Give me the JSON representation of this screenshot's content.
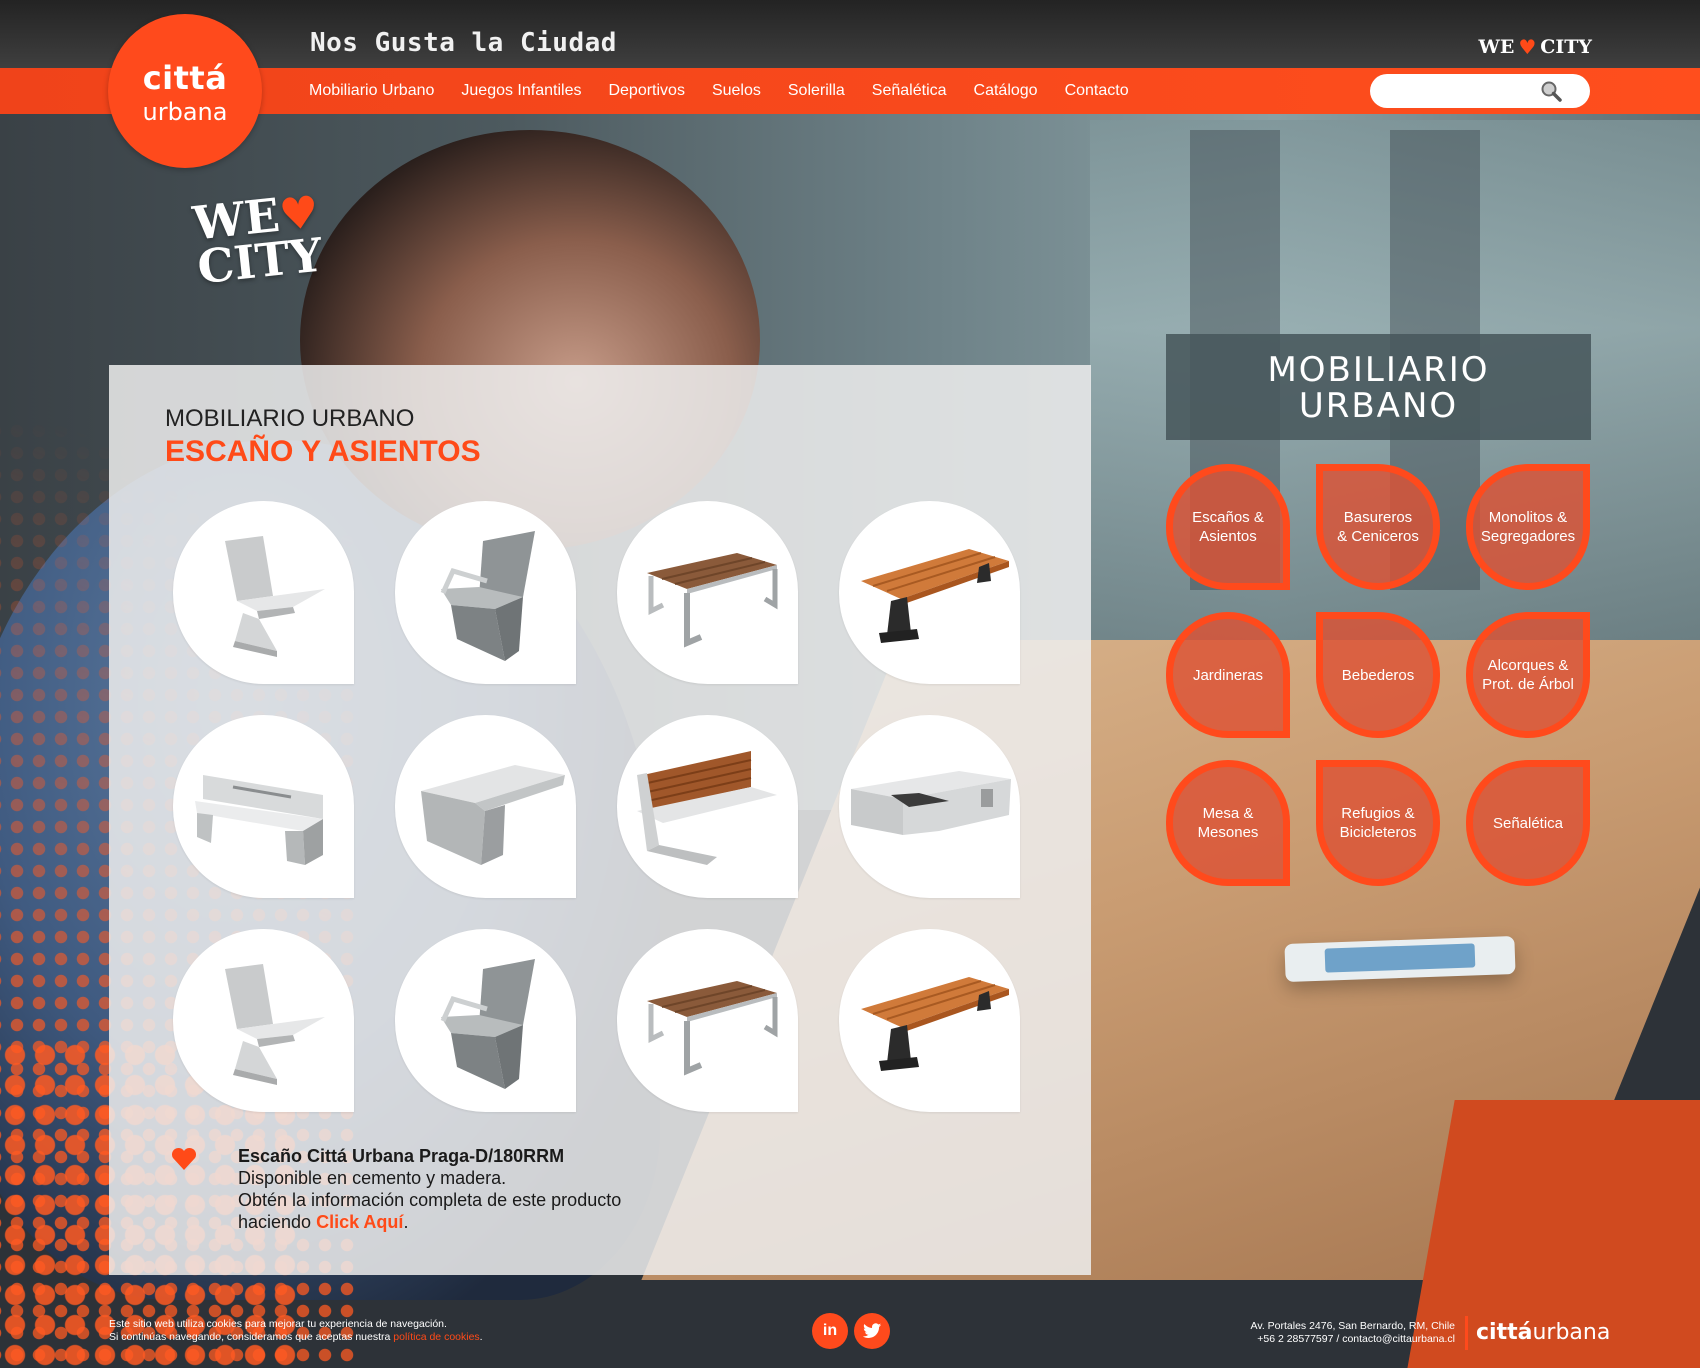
{
  "header": {
    "tagline": "Nos Gusta la Ciudad",
    "we_love": "WE",
    "city": "CITY",
    "logo_line1": "cittá",
    "logo_line2": "urbana",
    "search_placeholder": "",
    "nav": [
      "Mobiliario Urbano",
      "Juegos Infantiles",
      "Deportivos",
      "Suelos",
      "Solerilla",
      "Señalética",
      "Catálogo",
      "Contacto"
    ]
  },
  "badge": {
    "we": "WE",
    "city": "CITY"
  },
  "main": {
    "eyebrow": "MOBILIARIO URBANO",
    "heading": "ESCAÑO Y ASIENTOS",
    "products": [
      {
        "icon": "concrete-chair"
      },
      {
        "icon": "concrete-armchair"
      },
      {
        "icon": "metal-wood-bench"
      },
      {
        "icon": "wood-bench"
      },
      {
        "icon": "concrete-backrest-bench"
      },
      {
        "icon": "concrete-block-seat"
      },
      {
        "icon": "wood-slat-backrest-bench"
      },
      {
        "icon": "concrete-long-bench"
      },
      {
        "icon": "concrete-chair"
      },
      {
        "icon": "concrete-armchair"
      },
      {
        "icon": "metal-wood-bench"
      },
      {
        "icon": "wood-bench"
      }
    ],
    "info": {
      "title": "Escaño Cittá Urbana Praga-D/180RRM",
      "line1": "Disponible en cemento y madera.",
      "line2": "Obtén la información completa de este producto",
      "line3_prefix": "haciendo ",
      "cta": "Click Aquí",
      "line3_suffix": "."
    }
  },
  "sidebar": {
    "title_line1": "MOBILIARIO",
    "title_line2": "URBANO",
    "categories": [
      {
        "l1": "Escaños &",
        "l2": "Asientos"
      },
      {
        "l1": "Basureros",
        "l2": "& Ceniceros"
      },
      {
        "l1": "Monolitos &",
        "l2": "Segregadores"
      },
      {
        "l1": "Jardineras",
        "l2": ""
      },
      {
        "l1": "Bebederos",
        "l2": ""
      },
      {
        "l1": "Alcorques &",
        "l2": "Prot. de Árbol"
      },
      {
        "l1": "Mesa &",
        "l2": "Mesones"
      },
      {
        "l1": "Refugios &",
        "l2": "Bicicleteros"
      },
      {
        "l1": "Señalética",
        "l2": ""
      }
    ]
  },
  "footer": {
    "cookies_line1": "Este sitio web utiliza cookies para mejorar tu experiencia de navegación.",
    "cookies_line2": "Si continúas navegando, consideramos que aceptas nuestra ",
    "cookies_link": "política de cookies",
    "cookies_end": ".",
    "social": [
      {
        "icon": "linkedin-icon",
        "label": "in"
      },
      {
        "icon": "twitter-icon",
        "label": "t"
      }
    ],
    "address_line1": "Av. Portales 2476, San Bernardo, RM, Chile",
    "address_line2": "+56 2 28577597 / contacto@cittaurbana.cl",
    "logo_bold": "cittá",
    "logo_rest": "urbana"
  },
  "colors": {
    "accent": "#ff4a1c",
    "dark": "#2d2d2d",
    "panel": "#eeeeee",
    "slate": "#48585c"
  }
}
